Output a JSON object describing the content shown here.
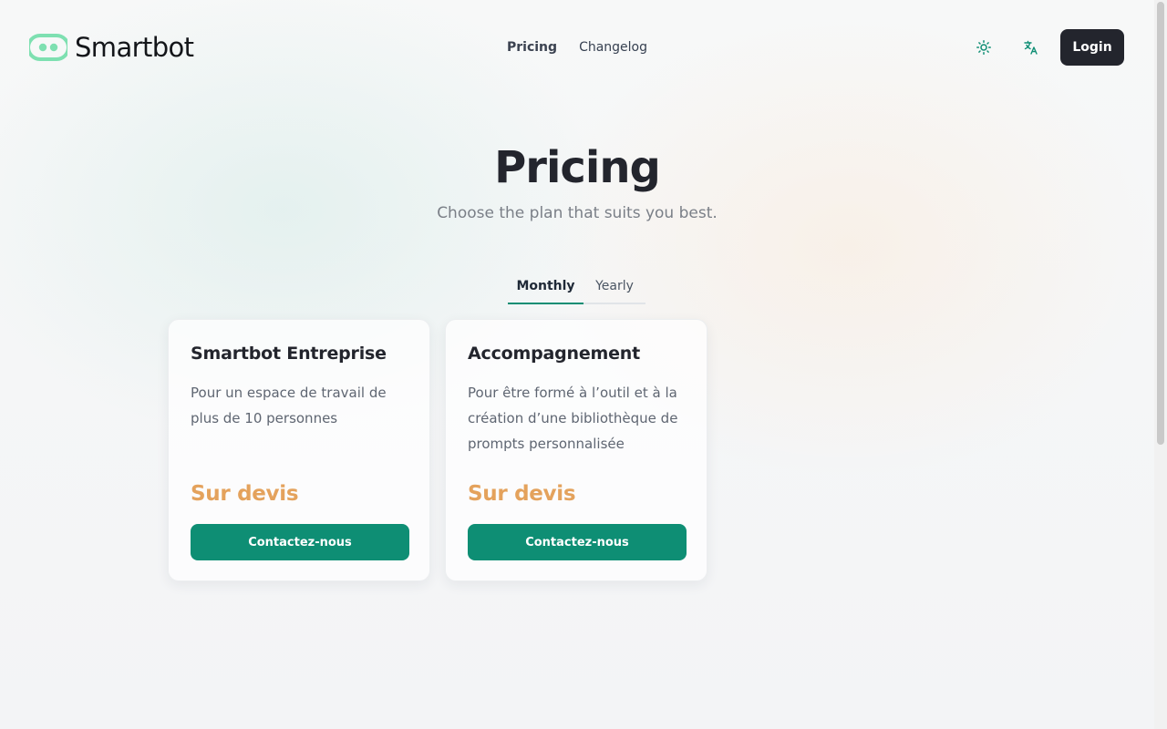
{
  "brand": {
    "name": "Smartbot",
    "logo_icon": "smartbot-logo-icon",
    "accent": "#0e8e74",
    "logo_color": "#6ee7b7"
  },
  "nav": {
    "items": [
      {
        "label": "Pricing",
        "active": true
      },
      {
        "label": "Changelog",
        "active": false
      }
    ]
  },
  "header": {
    "theme_icon": "sun-icon",
    "language_icon": "translate-icon",
    "login_label": "Login"
  },
  "page": {
    "title": "Pricing",
    "subtitle": "Choose the plan that suits you best."
  },
  "billing_tabs": [
    {
      "label": "Monthly",
      "selected": true
    },
    {
      "label": "Yearly",
      "selected": false
    }
  ],
  "plans": [
    {
      "name": "Smartbot Entreprise",
      "description": "Pour un espace de travail de plus de 10 personnes",
      "price": "Sur devis",
      "cta": "Contactez-nous"
    },
    {
      "name": "Accompagnement",
      "description": "Pour être formé à l’outil et à la création d’une bibliothèque de prompts personnalisée",
      "price": "Sur devis",
      "cta": "Contactez-nous"
    }
  ],
  "colors": {
    "price": "#e4a25c",
    "button": "#0e8e74",
    "login_bg": "#23252d"
  }
}
